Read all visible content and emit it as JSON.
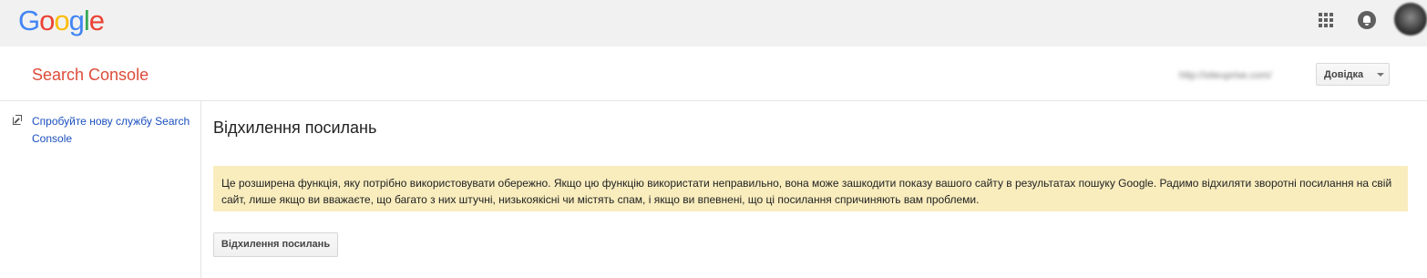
{
  "header": {
    "logo_letters": [
      {
        "char": "G",
        "color": "#4285f4"
      },
      {
        "char": "o",
        "color": "#ea4335"
      },
      {
        "char": "o",
        "color": "#fbbc05"
      },
      {
        "char": "g",
        "color": "#4285f4"
      },
      {
        "char": "l",
        "color": "#34a853"
      },
      {
        "char": "e",
        "color": "#ea4335"
      }
    ],
    "apps_icon": "apps-grid-icon",
    "notifications_icon": "bell-icon",
    "avatar_icon": "account-avatar"
  },
  "product": {
    "title": "Search Console",
    "site_url": "http://siteuprise.com/",
    "help_label": "Довідка"
  },
  "sidebar": {
    "link_icon": "external-link-icon",
    "link_text": "Спробуйте нову службу Search Console"
  },
  "main": {
    "title": "Відхилення посилань",
    "warning": "Це розширена функція, яку потрібно використовувати обережно. Якщо цю функцію використати неправильно, вона може зашкодити показу вашого сайту в результатах пошуку Google. Радимо відхиляти зворотні посилання на свій сайт, лише якщо ви вважаєте, що багато з них штучні, низькоякісні чи містять спам, і якщо ви впевнені, що ці посилання спричиняють вам проблеми.",
    "button_label": "Відхилення посилань"
  },
  "colors": {
    "topbar_bg": "#f1f1f1",
    "product_title": "#dd4b39",
    "link": "#1a4fbd",
    "warning_bg": "#f9edbe"
  }
}
